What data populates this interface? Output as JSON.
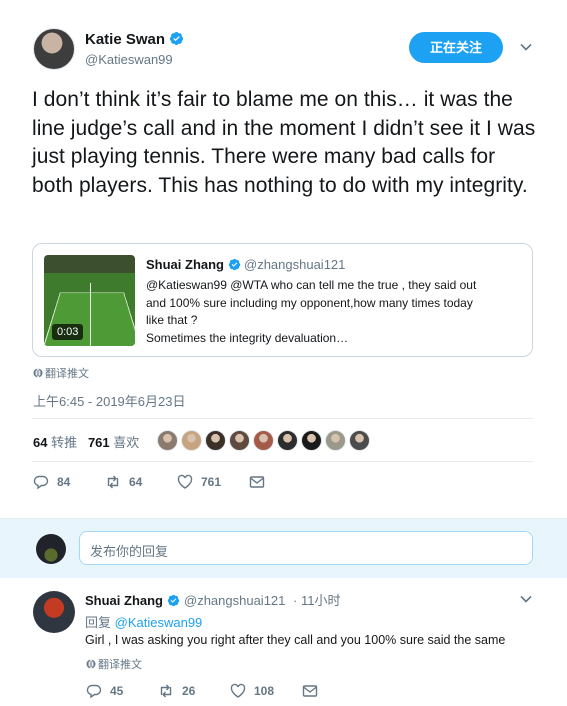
{
  "tweet": {
    "author_name": "Katie Swan",
    "author_handle": "@Katieswan99",
    "follow_label": "正在关注",
    "text": "I don’t think it’s fair to blame me on this… it was the line judge’s call and in the moment I didn’t see it I was just playing tennis. There were many bad calls for both players. This has nothing to do with my integrity.",
    "translate_label": "翻译推文",
    "timestamp": "上午6:45 - 2019年6月23日",
    "retweets_count": "64",
    "retweets_label": "转推",
    "likes_count": "761",
    "likes_label": "喜欢",
    "actions": {
      "replies": "84",
      "retweets": "64",
      "likes": "761"
    }
  },
  "quoted": {
    "name": "Shuai Zhang",
    "handle": "@zhangshuai121",
    "text_line1": "@Katieswan99 @WTA who can tell me the true , they said out",
    "text_line2": "and 100% sure including my opponent,how many times today",
    "text_line3": "like that ?",
    "text_line4": "Sometimes the integrity devaluation…",
    "video_duration": "0:03"
  },
  "compose": {
    "placeholder": "发布你的回复"
  },
  "reply": {
    "name": "Shuai Zhang",
    "handle": "@zhangshuai121",
    "time": "· 11小时",
    "reply_prefix": "回复",
    "reply_to": "@Katieswan99",
    "text": "Girl , I was asking you right after they call and you 100% sure said the same",
    "translate_label": "翻译推文",
    "actions": {
      "replies": "45",
      "retweets": "26",
      "likes": "108"
    }
  },
  "colors": {
    "accent": "#1da1f2",
    "muted": "#657786",
    "text": "#14171a",
    "band": "#e8f5fd"
  },
  "likers": [
    "#8a7b6e",
    "#c8a37f",
    "#3b3129",
    "#5e4a3f",
    "#a45b4a",
    "#2d2d2d",
    "#1a1a1a",
    "#9a9a8a",
    "#4c4c4c"
  ]
}
